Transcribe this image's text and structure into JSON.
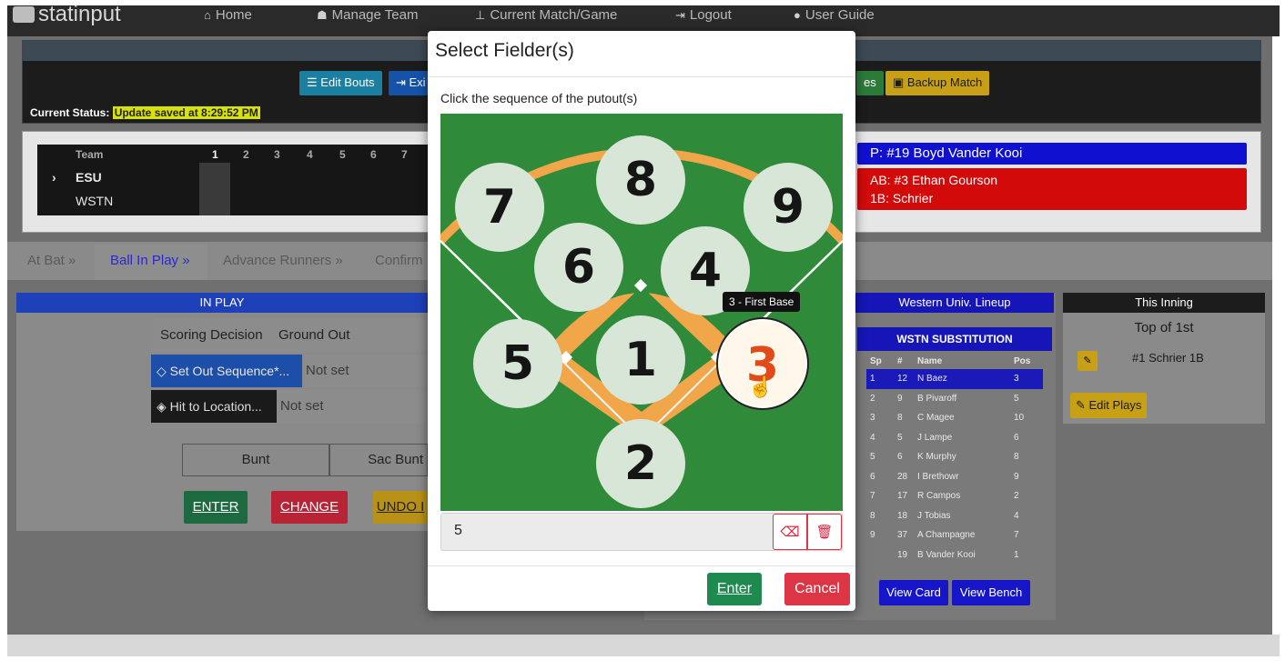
{
  "app": {
    "logo_text": "statinput"
  },
  "nav": {
    "items": [
      {
        "label": "Home",
        "icon": "home-icon"
      },
      {
        "label": "Manage Team",
        "icon": "team-icon"
      },
      {
        "label": "Current Match/Game",
        "icon": "match-icon"
      },
      {
        "label": "Logout",
        "icon": "logout-icon"
      },
      {
        "label": "User Guide",
        "icon": "info-icon"
      }
    ]
  },
  "status": {
    "edit_bouts": "Edit Bouts",
    "exit_partial": "Exi",
    "subs_partial": "es",
    "backup_match": "Backup Match",
    "current_status_label": "Current Status:",
    "current_status_value": "Update saved at 8:29:52 PM"
  },
  "scoreboard": {
    "team_header": "Team",
    "innings": [
      "1",
      "2",
      "3",
      "4",
      "5",
      "6",
      "7"
    ],
    "teams": [
      "ESU",
      "WSTN"
    ],
    "pitcher": "P: #19 Boyd Vander Kooi",
    "batter": "AB: #3 Ethan Gourson",
    "runner": "1B: Schrier"
  },
  "tabs": [
    "At Bat",
    "Ball In Play",
    "Advance Runners",
    "Confirm"
  ],
  "inplay": {
    "header": "IN PLAY",
    "scoring_decision_label": "Scoring Decision",
    "scoring_decision_value": "Ground Out",
    "set_out_sequence_label": "Set Out Sequence*...",
    "set_out_sequence_value": "Not set",
    "hit_location_label": "Hit to Location...",
    "hit_location_value": "Not set",
    "bunt": "Bunt",
    "sac_bunt": "Sac Bunt",
    "enter": "ENTER",
    "change": "CHANGE",
    "undo": "UNDO I"
  },
  "lineup": {
    "header": "Western Univ. Lineup",
    "subheader": "WSTN SUBSTITUTION",
    "columns": [
      "Sp",
      "#",
      "Name",
      "Pos"
    ],
    "rows": [
      [
        "1",
        "12",
        "N Baez",
        "3"
      ],
      [
        "2",
        "9",
        "B Pivaroff",
        "5"
      ],
      [
        "3",
        "8",
        "C Magee",
        "10"
      ],
      [
        "4",
        "5",
        "J Lampe",
        "6"
      ],
      [
        "5",
        "6",
        "K Murphy",
        "8"
      ],
      [
        "6",
        "28",
        "I Brethowr",
        "9"
      ],
      [
        "7",
        "17",
        "R Campos",
        "2"
      ],
      [
        "8",
        "18",
        "J Tobias",
        "4"
      ],
      [
        "9",
        "37",
        "A Champagne",
        "7"
      ],
      [
        "",
        "19",
        "B Vander Kooi",
        "1"
      ]
    ],
    "view_card": "View Card",
    "view_bench": "View Bench"
  },
  "inning": {
    "header": "This Inning",
    "title": "Top of 1st",
    "play": "#1 Schrier 1B",
    "edit_plays": "Edit Plays"
  },
  "modal": {
    "title": "Select Fielder(s)",
    "instruction": "Click the sequence of the putout(s)",
    "positions": [
      "8",
      "7",
      "9",
      "6",
      "4",
      "5",
      "1",
      "3",
      "2"
    ],
    "tooltip": "3 - First Base",
    "sequence_value": "5",
    "enter": "Enter",
    "cancel": "Cancel"
  },
  "colors": {
    "field_green": "#2f8a3a",
    "infield_orange": "#f2a64a",
    "enter_green": "#1f8a4f",
    "cancel_red": "#dc3545",
    "primary_blue": "#1616c8"
  }
}
